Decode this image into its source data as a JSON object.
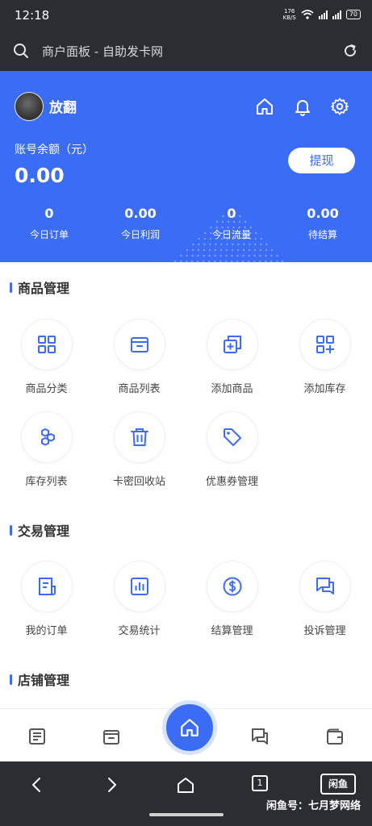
{
  "status_bar": {
    "time": "12:18",
    "net_speed_top": "176",
    "net_speed_bottom": "KB/S",
    "battery": "70"
  },
  "browser": {
    "title": "商户面板 - 自助发卡网",
    "search_icon": "search-icon",
    "refresh_icon": "refresh-icon"
  },
  "header": {
    "username": "放翻",
    "balance_label": "账号余额（元）",
    "balance_value": "0.00",
    "withdraw_label": "提现",
    "icons": [
      "home-icon",
      "bell-icon",
      "gear-icon"
    ],
    "stats": [
      {
        "value": "0",
        "label": "今日订单"
      },
      {
        "value": "0.00",
        "label": "今日利润"
      },
      {
        "value": "0",
        "label": "今日流量"
      },
      {
        "value": "0.00",
        "label": "待结算"
      }
    ]
  },
  "sections": {
    "goods": {
      "title": "商品管理",
      "items": [
        {
          "label": "商品分类",
          "icon": "grid-icon"
        },
        {
          "label": "商品列表",
          "icon": "box-icon"
        },
        {
          "label": "添加商品",
          "icon": "copy-plus-icon"
        },
        {
          "label": "添加库存",
          "icon": "grid-plus-icon"
        },
        {
          "label": "库存列表",
          "icon": "hexagons-icon"
        },
        {
          "label": "卡密回收站",
          "icon": "trash-icon"
        },
        {
          "label": "优惠券管理",
          "icon": "tag-icon"
        }
      ]
    },
    "trade": {
      "title": "交易管理",
      "items": [
        {
          "label": "我的订单",
          "icon": "order-icon"
        },
        {
          "label": "交易统计",
          "icon": "chart-icon"
        },
        {
          "label": "结算管理",
          "icon": "dollar-icon"
        },
        {
          "label": "投诉管理",
          "icon": "chat-icon"
        }
      ]
    },
    "shop": {
      "title": "店铺管理"
    }
  },
  "bottom_nav": {
    "icons": [
      "document-icon",
      "box-icon",
      "home-icon",
      "chat-icon",
      "wallet-icon"
    ]
  },
  "system_nav": {
    "tabs_count": "1",
    "logo_text": "闲鱼",
    "watermark": "闲鱼号：七月梦网络"
  },
  "colors": {
    "primary": "#3b6cf5",
    "dark_bar": "#2b2d33"
  }
}
